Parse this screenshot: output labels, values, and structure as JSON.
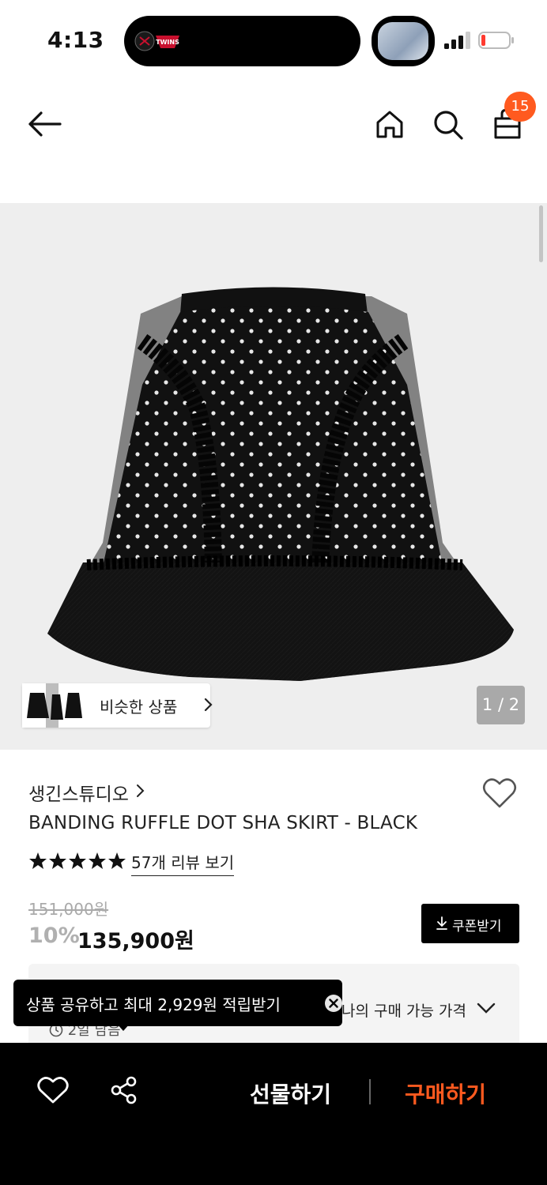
{
  "status_bar": {
    "time": "4:13",
    "island_logo_text": "TWINS"
  },
  "header": {
    "cart_count": "15",
    "icons": [
      "back-arrow-icon",
      "home-icon",
      "search-icon",
      "shopping-bag-icon"
    ]
  },
  "gallery": {
    "similar_label": "비슷한 상품",
    "page_indicator": "1 / 2"
  },
  "product": {
    "brand": "생긴스튜디오",
    "title": "BANDING RUFFLE DOT SHA SKIRT - BLACK",
    "rating": 5,
    "reviews_link": "57개 리뷰 보기",
    "original_price": "151,000원",
    "discount": "10%",
    "price": "135,900원",
    "coupon_label": "쿠폰받기",
    "my_price_label": "나의 구매 가능 가격",
    "time_left": "2일 남음"
  },
  "toast": {
    "text": "상품 공유하고 최대 2,929원 적립받기"
  },
  "bottom_bar": {
    "gift_label": "선물하기",
    "buy_label": "구매하기"
  },
  "colors": {
    "accent": "#ff5a1f",
    "gallery_bg": "#eeeeee"
  }
}
